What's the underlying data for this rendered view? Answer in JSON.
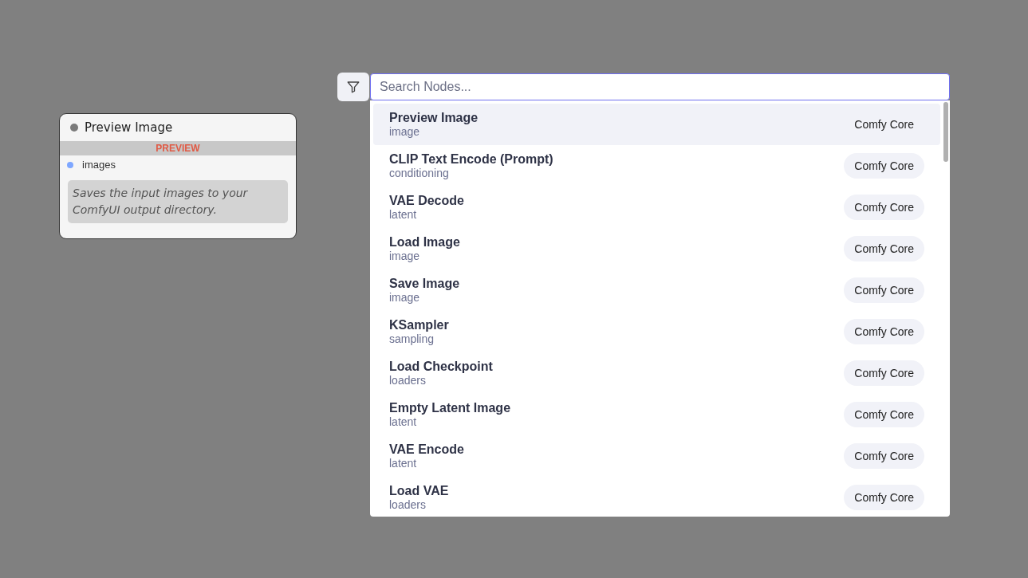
{
  "node": {
    "title": "Preview Image",
    "section": "PREVIEW",
    "inputs": [
      {
        "label": "images",
        "color": "#7ea7ff"
      }
    ],
    "description": "Saves the input images to your ComfyUI output directory."
  },
  "search": {
    "placeholder": "Search Nodes..."
  },
  "results": [
    {
      "name": "Preview Image",
      "category": "image",
      "source": "Comfy Core",
      "selected": true
    },
    {
      "name": "CLIP Text Encode (Prompt)",
      "category": "conditioning",
      "source": "Comfy Core",
      "selected": false
    },
    {
      "name": "VAE Decode",
      "category": "latent",
      "source": "Comfy Core",
      "selected": false
    },
    {
      "name": "Load Image",
      "category": "image",
      "source": "Comfy Core",
      "selected": false
    },
    {
      "name": "Save Image",
      "category": "image",
      "source": "Comfy Core",
      "selected": false
    },
    {
      "name": "KSampler",
      "category": "sampling",
      "source": "Comfy Core",
      "selected": false
    },
    {
      "name": "Load Checkpoint",
      "category": "loaders",
      "source": "Comfy Core",
      "selected": false
    },
    {
      "name": "Empty Latent Image",
      "category": "latent",
      "source": "Comfy Core",
      "selected": false
    },
    {
      "name": "VAE Encode",
      "category": "latent",
      "source": "Comfy Core",
      "selected": false
    },
    {
      "name": "Load VAE",
      "category": "loaders",
      "source": "Comfy Core",
      "selected": false
    }
  ]
}
